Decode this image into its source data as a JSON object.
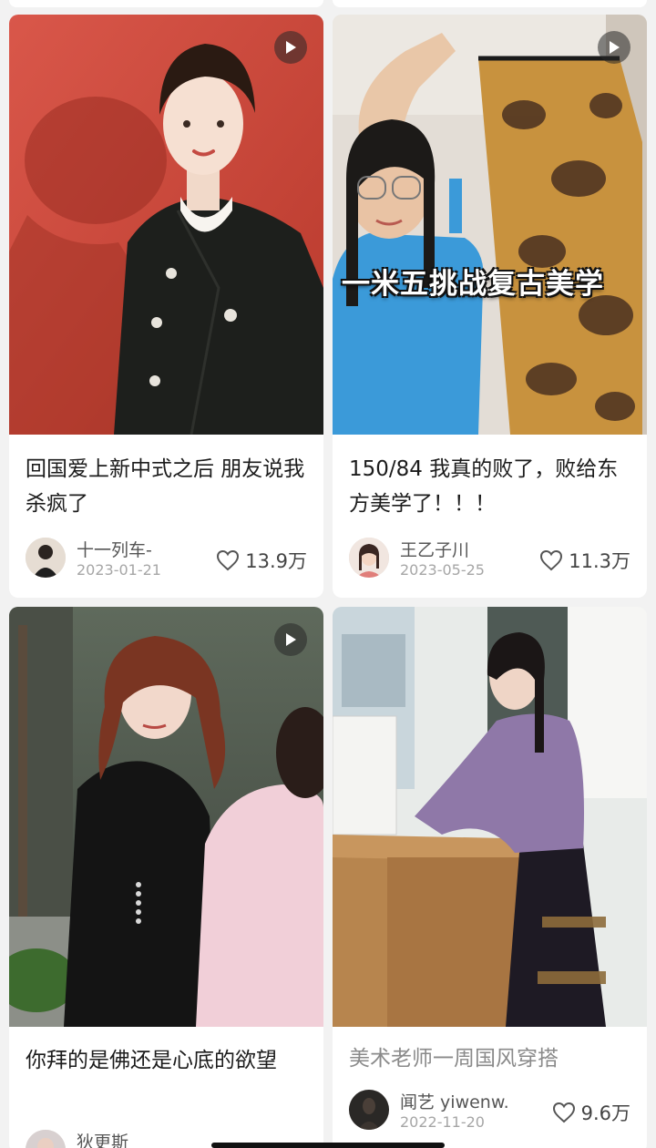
{
  "feed": {
    "cards": [
      {
        "title": "回国爱上新中式之后 朋友说我杀疯了",
        "author": "十一列车-",
        "date": "2023-01-21",
        "likes": "13.9万",
        "is_video": true,
        "overlay_text": ""
      },
      {
        "title": "150/84 我真的败了，败给东方美学了！！！",
        "author": "王乙子川",
        "date": "2023-05-25",
        "likes": "11.3万",
        "is_video": true,
        "overlay_text": "一米五挑战复古美学"
      },
      {
        "title": "你拜的是佛还是心底的欲望",
        "author": "狄更斯",
        "date": "",
        "likes": "",
        "is_video": true,
        "overlay_text": ""
      },
      {
        "title": "美术老师一周国风穿搭",
        "author": "闻艺 yiwenw.",
        "date": "2022-11-20",
        "likes": "9.6万",
        "is_video": false,
        "overlay_text": ""
      }
    ]
  },
  "icons": {
    "play": "play-icon",
    "like": "heart-outline-icon"
  },
  "colors": {
    "background": "#f2f2f2",
    "card": "#ffffff",
    "title_text": "#1c1c1c",
    "meta_text": "#a6a6a6"
  }
}
